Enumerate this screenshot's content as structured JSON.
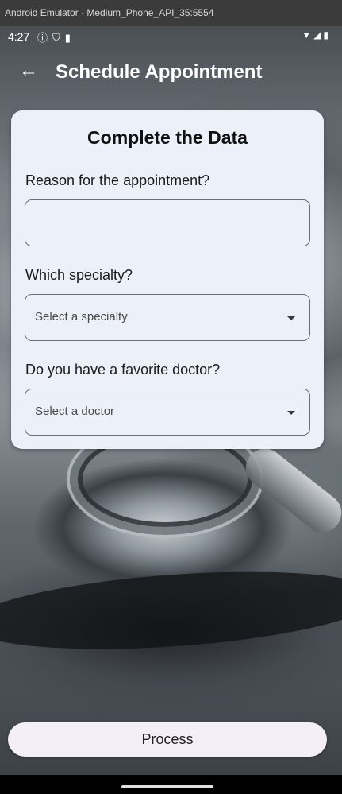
{
  "emulator": {
    "title": "Android Emulator - Medium_Phone_API_35:5554"
  },
  "status_bar": {
    "time": "4:27",
    "left_icons": [
      "info-circle-icon",
      "shield-icon",
      "sim-card-icon"
    ],
    "right_icons": [
      "wifi-icon",
      "signal-icon",
      "battery-icon"
    ]
  },
  "app_bar": {
    "back_icon": "arrow-back-icon",
    "title": "Schedule Appointment"
  },
  "form": {
    "title": "Complete the Data",
    "reason": {
      "label": "Reason for the appointment?",
      "value": ""
    },
    "specialty": {
      "label": "Which specialty?",
      "selected": "Select a specialty"
    },
    "doctor": {
      "label": "Do you have a favorite doctor?",
      "selected": "Select a doctor"
    }
  },
  "actions": {
    "process_label": "Process"
  }
}
